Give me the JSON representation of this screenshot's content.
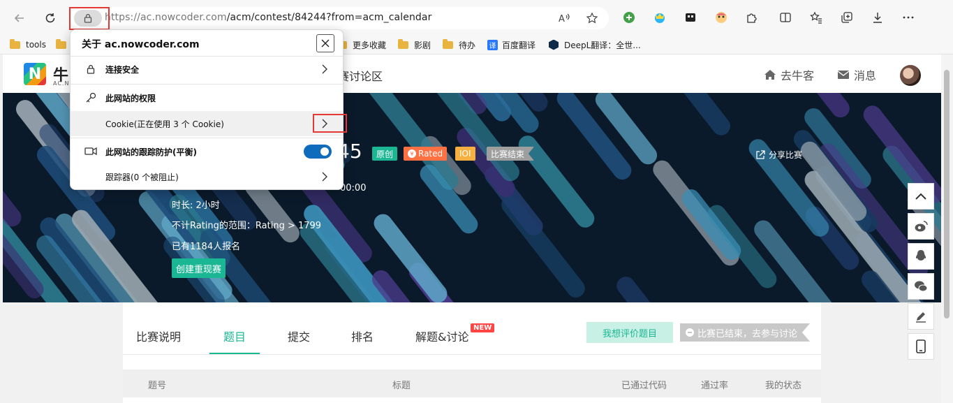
{
  "browser": {
    "url_host": "https://ac.nowcoder.com",
    "url_path": "/acm/contest/84244?from=acm_calendar",
    "bookmarks": [
      {
        "label": "tools",
        "icon": "folder-icon"
      },
      {
        "label": "更多收藏",
        "icon": "folder-icon"
      },
      {
        "label": "影剧",
        "icon": "folder-icon"
      },
      {
        "label": "待办",
        "icon": "folder-icon"
      },
      {
        "label": "百度翻译",
        "icon": "baidu-translate-icon"
      },
      {
        "label": "DeepL翻译：全世...",
        "icon": "deepl-icon"
      }
    ]
  },
  "site_info_popup": {
    "title": "关于 ac.nowcoder.com",
    "connection": "连接安全",
    "permissions": "此网站的权限",
    "cookie": "Cookie(正在使用 3 个 Cookie)",
    "tracking": "此网站的跟踪防护(平衡)",
    "tracking_enabled": true,
    "trackers": "跟踪器(0 个被阻止)"
  },
  "site": {
    "logo_char": "N",
    "logo_text": "牛",
    "logo_sub": "AC.N",
    "nav_partial": "赛讨论区",
    "go_nowcoder": "去牛客",
    "messages": "消息"
  },
  "contest": {
    "title_partial": "45",
    "tags": [
      "原创",
      "Rated",
      "IOI",
      "比赛结束"
    ],
    "time_partial": "00:00",
    "duration": "时长: 2小时",
    "rating_range": "不计Rating的范围：Rating > 1799",
    "registered": "已有1184人报名",
    "create_replay": "创建重现赛",
    "share": "分享比赛"
  },
  "tabs": {
    "items": [
      "比赛说明",
      "题目",
      "提交",
      "排名",
      "解题&讨论"
    ],
    "active": "题目",
    "new_badge": "NEW",
    "rate_button": "我想评价题目",
    "ended_notice": "比赛已结束，去参与讨论"
  },
  "table": {
    "headers": [
      "题号",
      "标题",
      "已通过代码",
      "通过率",
      "我的状态"
    ]
  },
  "colors": {
    "accent": "#1bb795",
    "tag_original": "#1bb795",
    "tag_rated": "#ff7043",
    "tag_ioi": "#f5b041",
    "tag_ended": "#9e9e9e",
    "highlight": "#e53935",
    "toggle": "#0f6cbd"
  }
}
